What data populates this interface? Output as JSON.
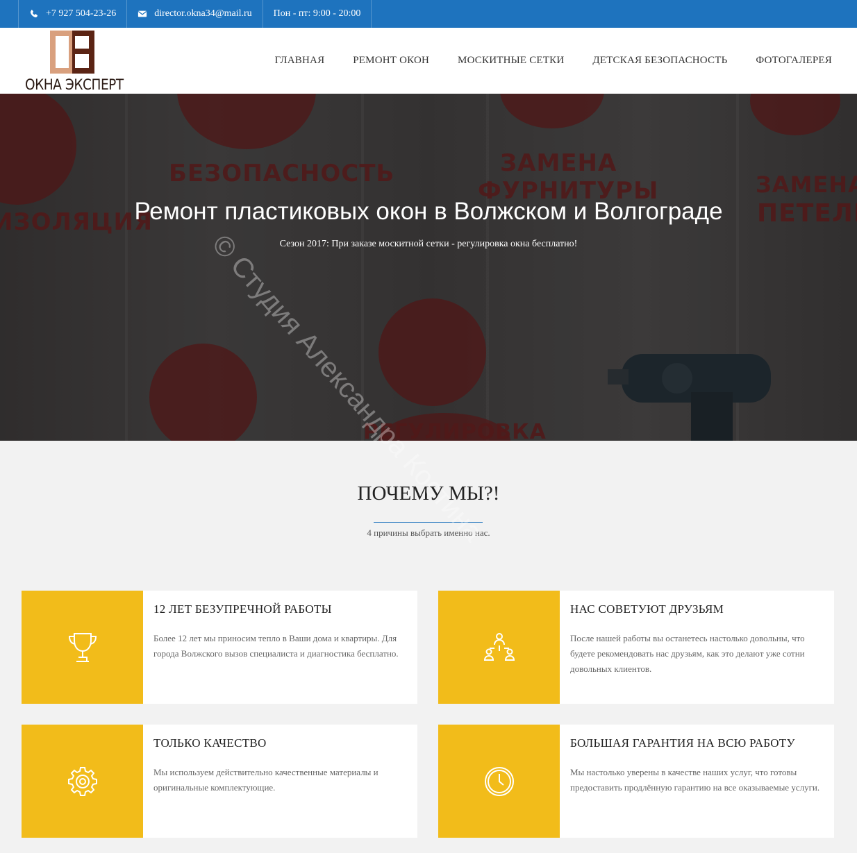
{
  "topbar": {
    "phone": "+7 927 504-23-26",
    "email": "director.okna34@mail.ru",
    "hours": "Пон - пт: 9:00 - 20:00"
  },
  "logo": {
    "text": "ОКНА ЭКСПЕРТ"
  },
  "nav": [
    {
      "label": "ГЛАВНАЯ"
    },
    {
      "label": "РЕМОНТ ОКОН"
    },
    {
      "label": "МОСКИТНЫЕ СЕТКИ"
    },
    {
      "label": "ДЕТСКАЯ БЕЗОПАСНОСТЬ"
    },
    {
      "label": "ФОТОГАЛЕРЕЯ"
    }
  ],
  "hero": {
    "title": "Ремонт пластиковых окон в Волжском и Волгограде",
    "subtitle": "Сезон 2017: При заказе москитной сетки - регулировка окна бесплатно!",
    "background_words": [
      "БЕЗОПАСНОСТЬ",
      "ЗАМЕНА",
      "ФУРНИТУРЫ",
      "ЗАМЕНА",
      "ПЕТЕЛЬ",
      "ИЗОЛЯЦИЯ",
      "РЕГУЛИРОВКА"
    ]
  },
  "why": {
    "title": "ПОЧЕМУ МЫ?!",
    "subtitle": "4 причины выбрать именно нас.",
    "cards": [
      {
        "title": "12 ЛЕТ БЕЗУПРЕЧНОЙ РАБОТЫ",
        "text": "Более 12 лет мы приносим тепло в Ваши дома и квартиры. Для города Волжского вызов специалиста и диагностика бесплатно.",
        "icon": "trophy-icon"
      },
      {
        "title": "НАС СОВЕТУЮТ ДРУЗЬЯМ",
        "text": "После нашей работы вы останетесь настолько довольны, что будете рекомендовать нас друзьям, как это делают уже сотни довольных клиентов.",
        "icon": "network-people-icon"
      },
      {
        "title": "ТОЛЬКО КАЧЕСТВО",
        "text": "Мы используем действительно качественные материалы и оригинальные комплектующие.",
        "icon": "gear-icon"
      },
      {
        "title": "БОЛЬШАЯ ГАРАНТИЯ НА ВСЮ РАБОТУ",
        "text": "Мы настолько уверены в качестве наших услуг, что готовы предоставить продлённую гарантию на все оказываемые услуги.",
        "icon": "clock-icon"
      }
    ]
  },
  "watermark": "© Студия Александра Костина",
  "colors": {
    "topbar": "#1e73be",
    "accent": "#f2bc1a",
    "logo_light": "#d9a07e",
    "logo_dark": "#5b2414"
  }
}
